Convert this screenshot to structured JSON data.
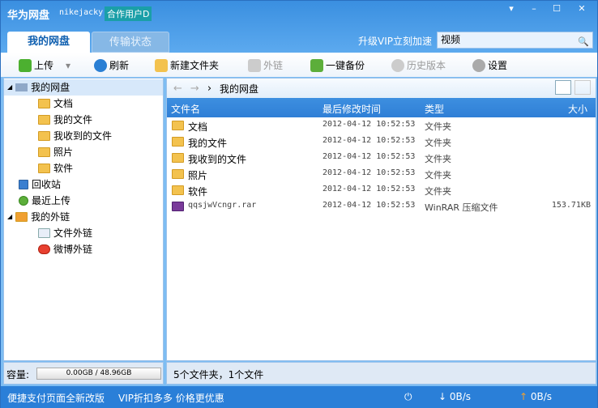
{
  "app": {
    "title": "华为网盘",
    "user": "nikejacky",
    "badge": "合作用户D"
  },
  "window": {
    "menu": "▾",
    "min": "–",
    "max": "☐",
    "close": "✕"
  },
  "tabs": [
    {
      "label": "我的网盘"
    },
    {
      "label": "传输状态"
    }
  ],
  "vip_link": "升级VIP立刻加速",
  "search": {
    "value": "视频"
  },
  "toolbar": {
    "upload": "上传",
    "refresh": "刷新",
    "new_folder": "新建文件夹",
    "external_link": "外链",
    "backup": "一键备份",
    "history": "历史版本",
    "settings": "设置"
  },
  "tree": {
    "root": "我的网盘",
    "children": [
      "文档",
      "我的文件",
      "我收到的文件",
      "照片",
      "软件"
    ],
    "recycle": "回收站",
    "recent": "最近上传",
    "links": "我的外链",
    "link_children": [
      "文件外链",
      "微博外链"
    ]
  },
  "breadcrumb": "我的网盘",
  "columns": [
    "文件名",
    "最后修改时间",
    "类型",
    "大小"
  ],
  "files": [
    {
      "name": "文档",
      "modified": "2012-04-12 10:52:53",
      "type": "文件夹",
      "size": ""
    },
    {
      "name": "我的文件",
      "modified": "2012-04-12 10:52:53",
      "type": "文件夹",
      "size": ""
    },
    {
      "name": "我收到的文件",
      "modified": "2012-04-12 10:52:53",
      "type": "文件夹",
      "size": ""
    },
    {
      "name": "照片",
      "modified": "2012-04-12 10:52:53",
      "type": "文件夹",
      "size": ""
    },
    {
      "name": "软件",
      "modified": "2012-04-12 10:52:53",
      "type": "文件夹",
      "size": ""
    },
    {
      "name": "qqsjwVcngr.rar",
      "modified": "2012-04-12 10:52:53",
      "type": "WinRAR 压缩文件",
      "size": "153.71KB"
    }
  ],
  "capacity": {
    "label": "容量:",
    "value": "0.00GB / 48.96GB"
  },
  "status": "5个文件夹，1个文件",
  "footer": {
    "promo1": "便捷支付页面全新改版",
    "promo2": "VIP折扣多多 价格更优惠",
    "down": "0B/s",
    "up": "0B/s"
  }
}
